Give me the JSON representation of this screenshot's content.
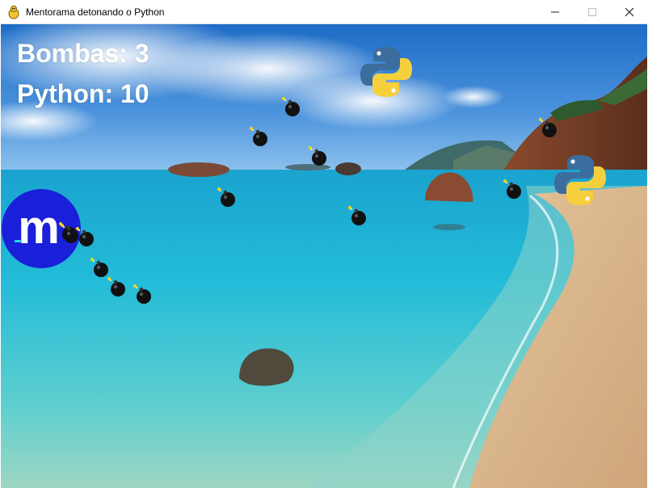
{
  "window": {
    "title": "Mentorama detonando o Python",
    "app_icon": "pygame-snake-icon",
    "controls": [
      "minimize-icon",
      "maximize-icon",
      "close-icon"
    ]
  },
  "hud": {
    "bombs_label": "Bombas: 3",
    "python_label": "Python: 10"
  },
  "player": {
    "logo_letter": "m",
    "color": "#1a1fd9"
  },
  "sprites": {
    "bomb_count": 13,
    "python_logo_count": 2
  },
  "colors": {
    "sky": "#3f86d4",
    "sea": "#22b8d8",
    "sand": "#dcb88e",
    "bomb": "#111111",
    "fuse_spark": "#f2d21a",
    "python_blue": "#3b6e9e",
    "python_yellow": "#f6cf3c",
    "player_blue": "#1a1fd9"
  }
}
